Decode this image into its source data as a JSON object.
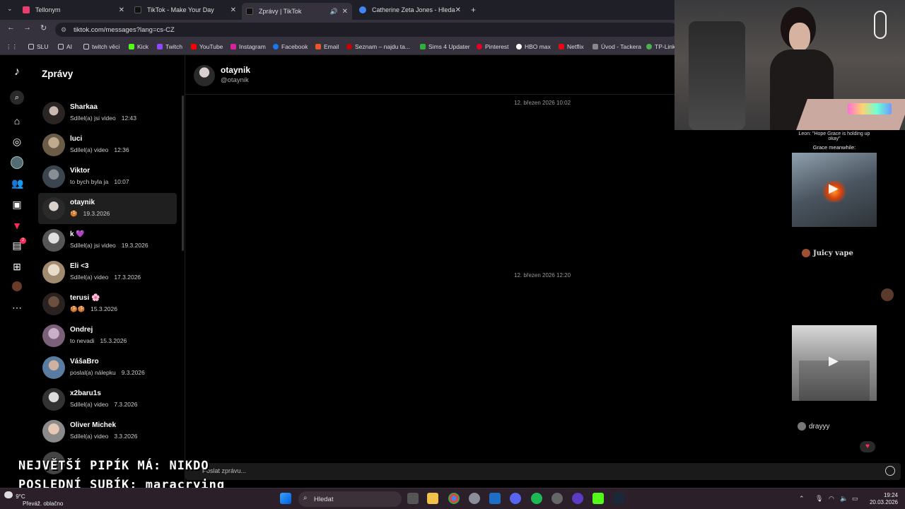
{
  "browser": {
    "tabs": [
      {
        "title": "Tellonym",
        "color": "#e83d6d"
      },
      {
        "title": "TikTok - Make Your Day",
        "color": "#111111"
      },
      {
        "title": "Zprávy | TikTok",
        "color": "#111111"
      },
      {
        "title": "Catherine Zeta Jones - Hledat G",
        "color": "#4285f4"
      }
    ],
    "url": "tiktok.com/messages?lang=cs-CZ",
    "bookmarks": [
      "SLU",
      "AI",
      "twitch věci",
      "Kick",
      "Twitch",
      "YouTube",
      "Instagram",
      "Facebook",
      "Email",
      "Seznam – najdu ta...",
      "Sims 4 Updater",
      "Pinterest",
      "HBO max",
      "Netflix",
      "Úvod - Tackera",
      "TP-Link"
    ]
  },
  "app": {
    "title": "Zprávy",
    "notification_count": "2"
  },
  "conversations": [
    {
      "name": "Sharkaa",
      "preview": "Sdílel(a) jsi video",
      "time": "12:43"
    },
    {
      "name": "luci",
      "preview": "Sdílel(a) video",
      "time": "12:36"
    },
    {
      "name": "Viktor",
      "preview": "to bych byla ja",
      "time": "10:07"
    },
    {
      "name": "otaynik",
      "preview": "🍪",
      "time": "19.3.2026"
    },
    {
      "name": "k 💜",
      "preview": "Sdílel(a) jsi video",
      "time": "19.3.2026"
    },
    {
      "name": "Eli <3",
      "preview": "Sdílel(a) video",
      "time": "17.3.2026"
    },
    {
      "name": "terusi 🌸",
      "preview": "🍪🍪",
      "time": "15.3.2026"
    },
    {
      "name": "Ondrej",
      "preview": "to nevadi",
      "time": "15.3.2026"
    },
    {
      "name": "VášaBro",
      "preview": "poslal(a) nálepku",
      "time": "9.3.2026"
    },
    {
      "name": "x2baru1s",
      "preview": "Sdílel(a) video",
      "time": "7.3.2026"
    },
    {
      "name": "Oliver Michek",
      "preview": "Sdílel(a) video",
      "time": "3.3.2026"
    }
  ],
  "chat": {
    "name": "otaynik",
    "handle": "@otaynik",
    "stamps": [
      "12. březen 2026 10:02",
      "12. březen 2026 12:20"
    ],
    "composer_placeholder": "Poslat zprávu...",
    "shared": {
      "caption_top": "Leon: \"Hope Grace is holding up okay\"",
      "caption": "Grace meanwhile:",
      "user1": "Juicy vape",
      "user2": "drayyy"
    }
  },
  "overlay": {
    "line1": "NEJVĚTŠÍ PIPÍK MÁ: NIKDO",
    "line2": "POSLEDNÍ SUBÍK: maracrying"
  },
  "taskbar": {
    "temp": "9°C",
    "weather": "Převáž. oblačno",
    "search": "Hledat",
    "time": "19:24",
    "date": "20.03.2026"
  }
}
